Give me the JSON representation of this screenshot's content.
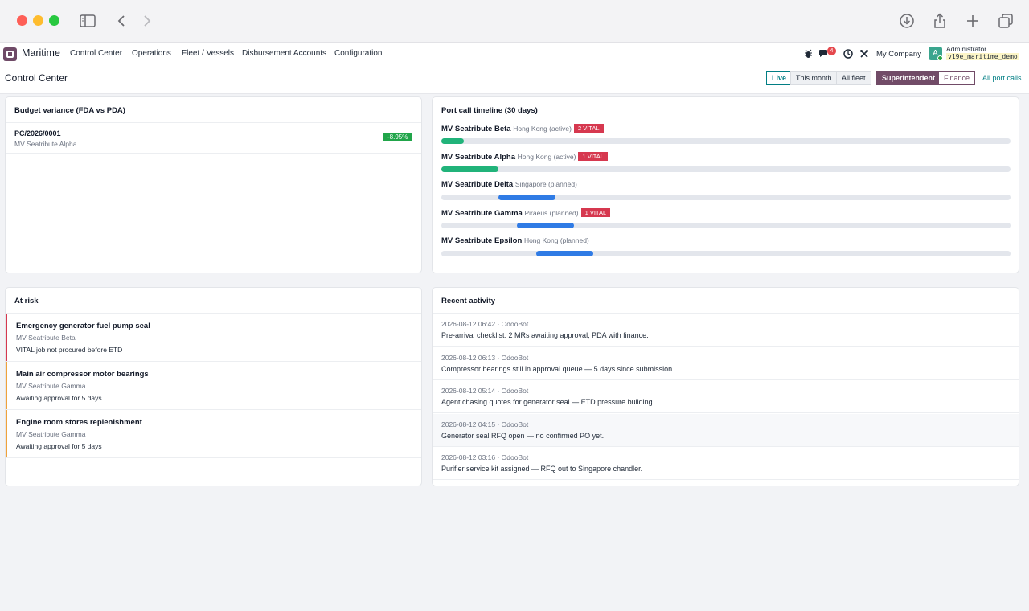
{
  "navbar": {
    "app_name": "Maritime",
    "menu": [
      "Control Center",
      "Operations",
      "Fleet / Vessels",
      "Disbursement Accounts",
      "Configuration"
    ],
    "message_count": "4",
    "company": "My Company",
    "avatar_letter": "A",
    "user_name": "Administrator",
    "database": "v19e_maritime_demo"
  },
  "control_panel": {
    "title": "Control Center",
    "filters": [
      "Live",
      "This month",
      "All fleet"
    ],
    "roles": [
      "Superintendent",
      "Finance"
    ],
    "all_port_calls": "All port calls"
  },
  "budget_variance": {
    "title": "Budget variance (FDA vs PDA)",
    "rows": [
      {
        "ref": "PC/2026/0001",
        "vessel": "MV Seatribute Alpha",
        "variance": "-8.95%"
      }
    ]
  },
  "port_calls": {
    "title": "Port call timeline (30 days)",
    "rows": [
      {
        "vessel": "MV Seatribute Beta",
        "detail": "Hong Kong (active)",
        "vital": "2 VITAL",
        "status": "active",
        "start": 0.0,
        "end": 0.04
      },
      {
        "vessel": "MV Seatribute Alpha",
        "detail": "Hong Kong (active)",
        "vital": "1 VITAL",
        "status": "active",
        "start": 0.0,
        "end": 0.1
      },
      {
        "vessel": "MV Seatribute Delta",
        "detail": "Singapore (planned)",
        "vital": "",
        "status": "planned",
        "start": 0.1,
        "end": 0.2
      },
      {
        "vessel": "MV Seatribute Gamma",
        "detail": "Piraeus (planned)",
        "vital": "1 VITAL",
        "status": "planned",
        "start": 0.133,
        "end": 0.233
      },
      {
        "vessel": "MV Seatribute Epsilon",
        "detail": "Hong Kong (planned)",
        "vital": "",
        "status": "planned",
        "start": 0.167,
        "end": 0.267
      }
    ],
    "colors": {
      "active": "#21b37a",
      "planned": "#2f7be5"
    }
  },
  "at_risk": {
    "title": "At risk",
    "items": [
      {
        "title": "Emergency generator fuel pump seal",
        "vessel": "MV Seatribute Beta",
        "note": "VITAL job not procured before ETD",
        "level": "critical"
      },
      {
        "title": "Main air compressor motor bearings",
        "vessel": "MV Seatribute Gamma",
        "note": "Awaiting approval for 5 days",
        "level": "warning"
      },
      {
        "title": "Engine room stores replenishment",
        "vessel": "MV Seatribute Gamma",
        "note": "Awaiting approval for 5 days",
        "level": "warning"
      }
    ],
    "colors": {
      "critical": "#d6384f",
      "warning": "#f0a23a"
    }
  },
  "activity": {
    "title": "Recent activity",
    "items": [
      {
        "meta": "2026-08-12 06:42 · OdooBot",
        "text": "Pre-arrival checklist: 2 MRs awaiting approval, PDA with finance."
      },
      {
        "meta": "2026-08-12 06:13 · OdooBot",
        "text": "Compressor bearings still in approval queue — 5 days since submission."
      },
      {
        "meta": "2026-08-12 05:14 · OdooBot",
        "text": "Agent chasing quotes for generator seal — ETD pressure building."
      },
      {
        "meta": "2026-08-12 04:15 · OdooBot",
        "text": "Generator seal RFQ open — no confirmed PO yet."
      },
      {
        "meta": "2026-08-12 03:16 · OdooBot",
        "text": "Purifier service kit assigned — RFQ out to Singapore chandler."
      }
    ]
  }
}
